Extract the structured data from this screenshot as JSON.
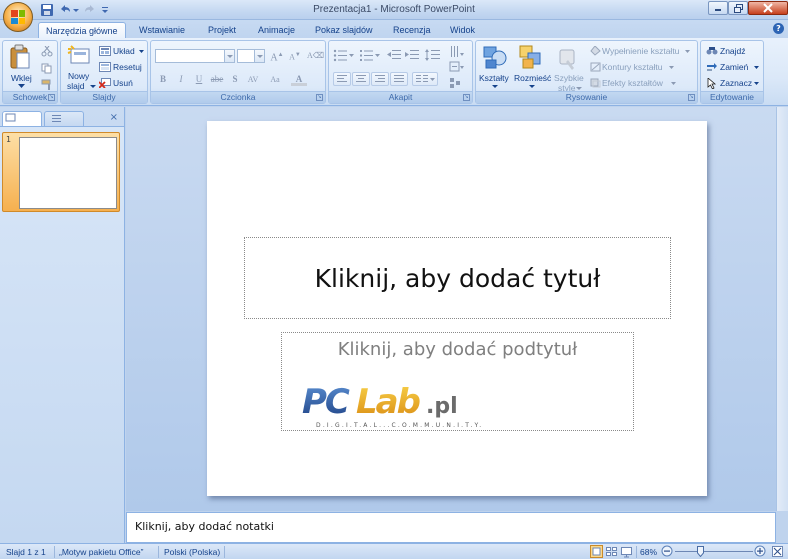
{
  "window": {
    "title": "Prezentacja1 - Microsoft PowerPoint"
  },
  "ribbon_tabs": [
    "Narzędzia główne",
    "Wstawianie",
    "Projekt",
    "Animacje",
    "Pokaz slajdów",
    "Recenzja",
    "Widok"
  ],
  "groups": {
    "schowek": {
      "label": "Schowek",
      "paste": "Wklej"
    },
    "slajdy": {
      "label": "Slajdy",
      "new_slide_1": "Nowy",
      "new_slide_2": "slajd",
      "layout": "Układ",
      "reset": "Resetuj",
      "delete": "Usuń"
    },
    "czcionka": {
      "label": "Czcionka"
    },
    "akapit": {
      "label": "Akapit"
    },
    "rysowanie": {
      "label": "Rysowanie",
      "shapes": "Kształty",
      "arrange": "Rozmieść",
      "quick_styles_1": "Szybkie",
      "quick_styles_2": "style",
      "fill": "Wypełnienie kształtu",
      "outline": "Kontury kształtu",
      "effects": "Efekty kształtów"
    },
    "edytowanie": {
      "label": "Edytowanie",
      "find": "Znajdź",
      "replace": "Zamień",
      "select": "Zaznacz"
    }
  },
  "slides_panel": {
    "thumb_number": "1"
  },
  "slide": {
    "title_placeholder": "Kliknij, aby dodać tytuł",
    "subtitle_placeholder": "Kliknij, aby dodać podtytuł",
    "logo_text": "PCLab.pl",
    "logo_tagline": "DIGITAL COMMUNITY"
  },
  "notes": {
    "placeholder": "Kliknij, aby dodać notatki"
  },
  "status": {
    "slide": "Slajd 1 z 1",
    "theme": "„Motyw pakietu Office”",
    "language": "Polski (Polska)",
    "zoom": "68%"
  },
  "colors": {
    "ribbon": "#dbe8f8",
    "accent": "#15428b",
    "office_button": "#f5b04a",
    "slide_bg": "#ffffff"
  }
}
